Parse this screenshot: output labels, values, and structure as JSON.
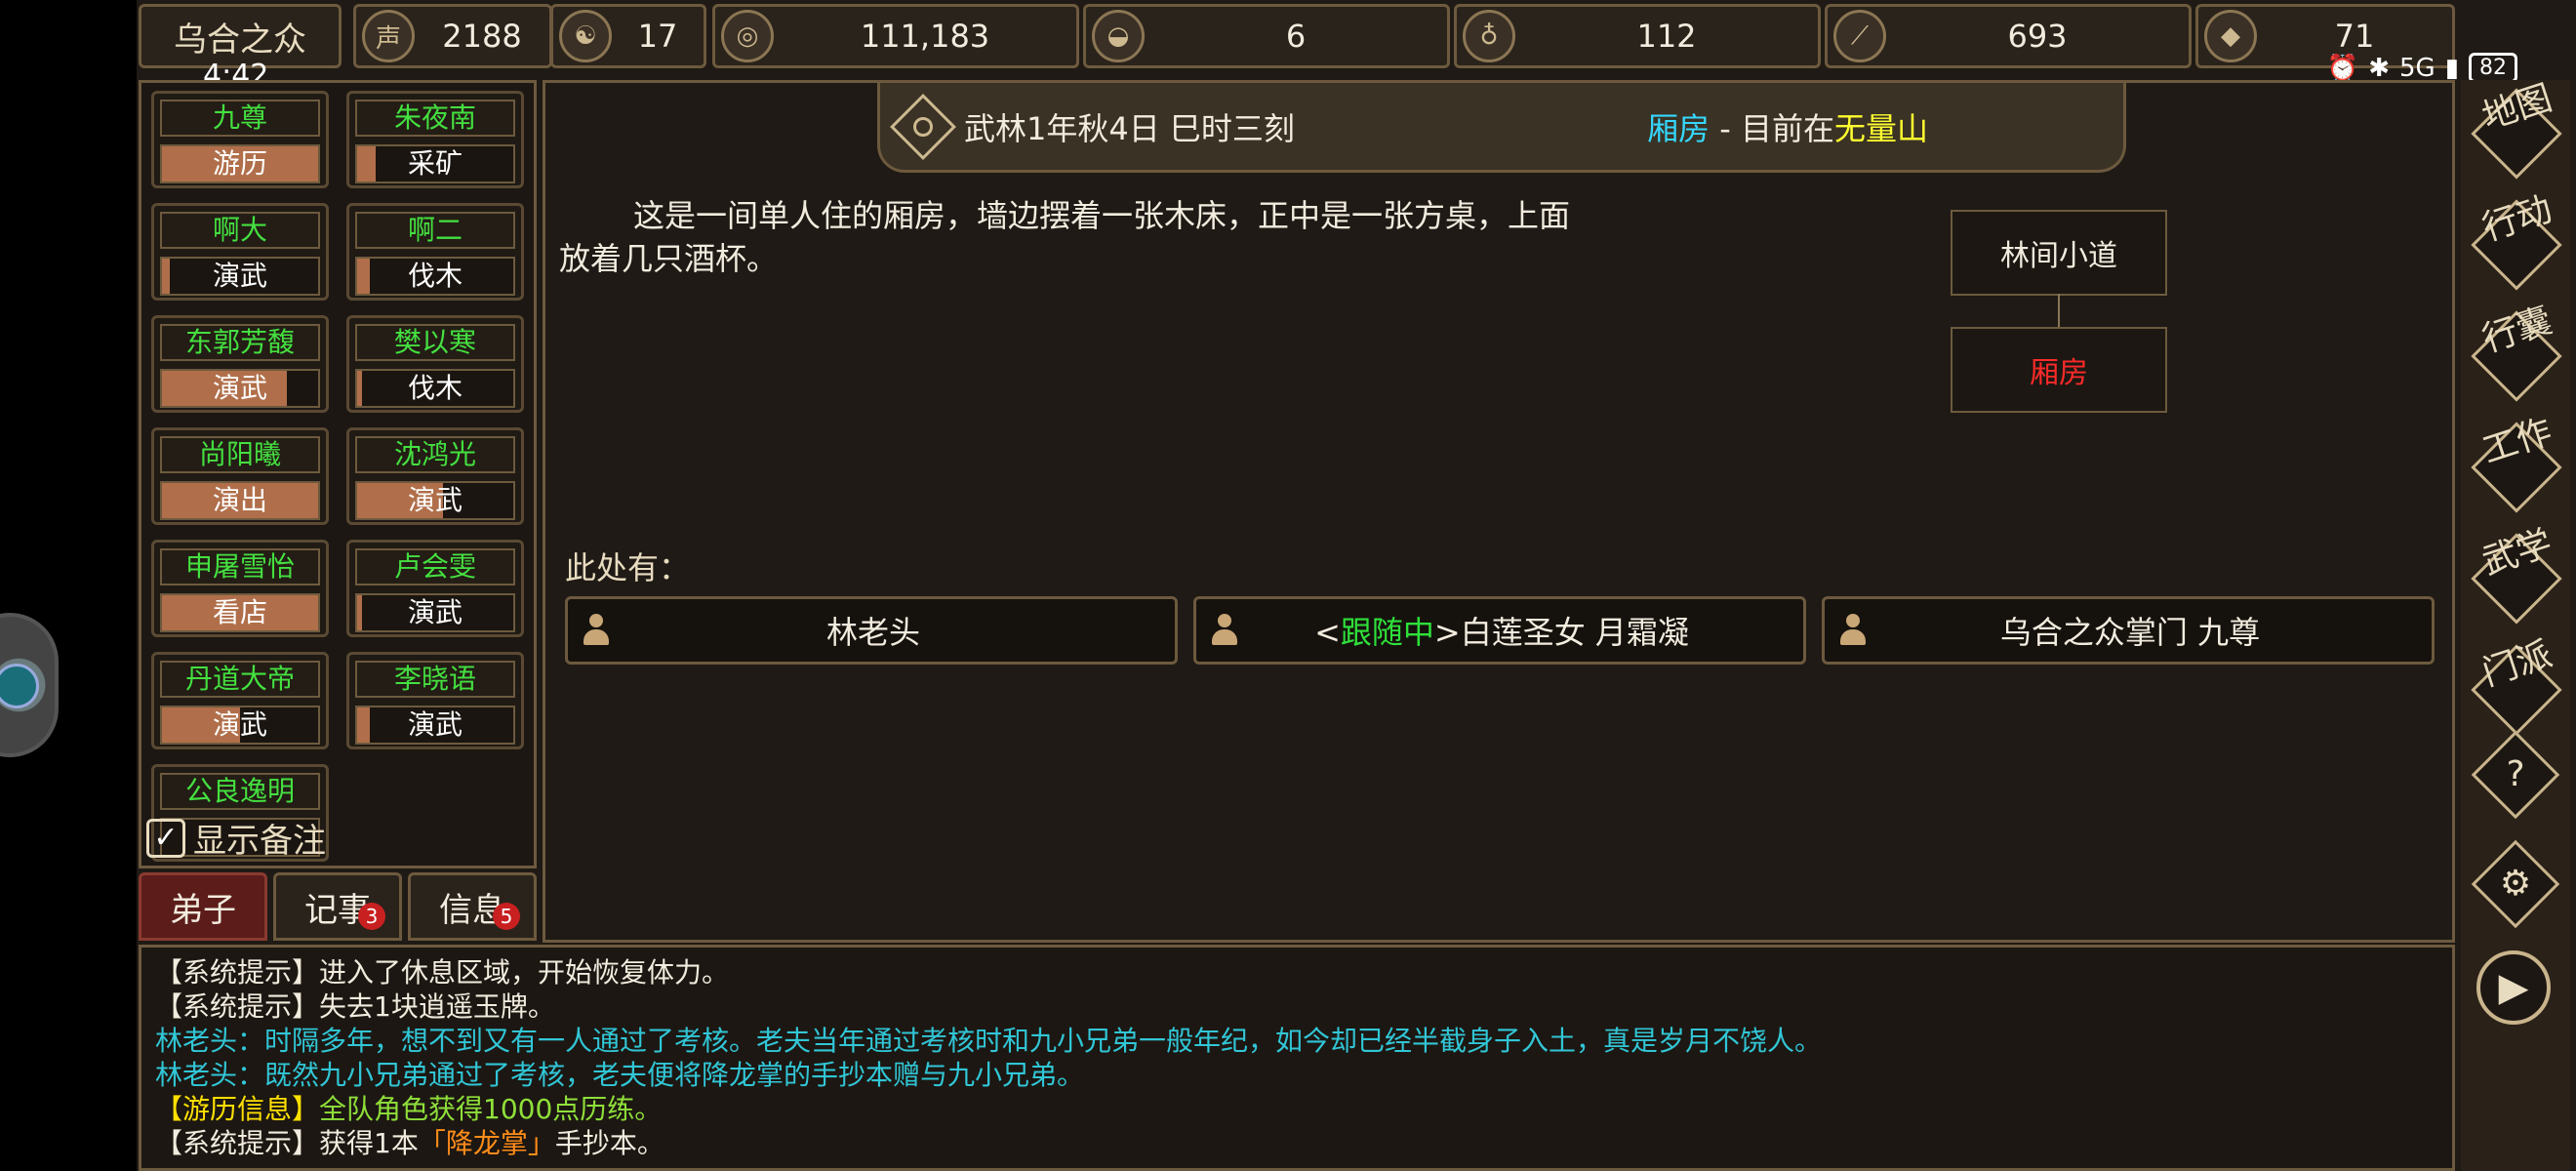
{
  "status_bar": {
    "time": "4:42",
    "battery": "82",
    "signal": "5G"
  },
  "topbar": {
    "sect_name": "乌合之众",
    "resources": [
      {
        "icon": "prestige-icon",
        "glyph": "声",
        "value": "2188"
      },
      {
        "icon": "yin-yang-icon",
        "glyph": "☯",
        "value": "17"
      },
      {
        "icon": "coin-icon",
        "glyph": "◎",
        "value": "111,183"
      },
      {
        "icon": "rice-bowl-icon",
        "glyph": "◒",
        "value": "6"
      },
      {
        "icon": "gourd-icon",
        "glyph": "♁",
        "value": "112"
      },
      {
        "icon": "timber-icon",
        "glyph": "⟋",
        "value": "693"
      },
      {
        "icon": "ore-icon",
        "glyph": "◆",
        "value": "71"
      }
    ]
  },
  "disciples": [
    {
      "name": "九尊",
      "task": "游历",
      "progress": 1.0
    },
    {
      "name": "朱夜南",
      "task": "采矿",
      "progress": 0.12
    },
    {
      "name": "啊大",
      "task": "演武",
      "progress": 0.05
    },
    {
      "name": "啊二",
      "task": "伐木",
      "progress": 0.08
    },
    {
      "name": "东郭芳馥",
      "task": "演武",
      "progress": 0.8
    },
    {
      "name": "樊以寒",
      "task": "伐木",
      "progress": 0.03
    },
    {
      "name": "尚阳曦",
      "task": "演出",
      "progress": 1.0
    },
    {
      "name": "沈鸿光",
      "task": "演武",
      "progress": 0.55
    },
    {
      "name": "申屠雪怡",
      "task": "看店",
      "progress": 1.0
    },
    {
      "name": "卢会雯",
      "task": "演武",
      "progress": 0.03
    },
    {
      "name": "丹道大帝",
      "task": "演武",
      "progress": 0.5
    },
    {
      "name": "李晓语",
      "task": "演武",
      "progress": 0.08
    },
    {
      "name": "公良逸明",
      "task": "",
      "progress": 0
    }
  ],
  "show_notes_label": "显示备注",
  "tabs": [
    {
      "label": "弟子",
      "badge": ""
    },
    {
      "label": "记事",
      "badge": "3"
    },
    {
      "label": "信息",
      "badge": "5"
    }
  ],
  "header": {
    "date": "武林1年秋4日 巳时三刻",
    "room": "厢房",
    "separator": " - 目前在",
    "area": "无量山"
  },
  "description": "这是一间单人住的厢房，墙边摆着一张木床，正中是一张方桌，上面放着几只酒杯。",
  "map": {
    "north": "林间小道",
    "current": "厢房"
  },
  "here_label": "此处有：",
  "npcs": [
    {
      "prefix": "",
      "tag": "",
      "suffix": "",
      "name": "林老头"
    },
    {
      "prefix": "<",
      "tag": "跟随中",
      "suffix": ">",
      "name": "白莲圣女 月霜凝"
    },
    {
      "prefix": "",
      "tag": "",
      "suffix": "",
      "name": "乌合之众掌门 九尊"
    }
  ],
  "right_menu": [
    "地图",
    "行动",
    "行囊",
    "工作",
    "武学",
    "门派"
  ],
  "right_buttons": {
    "help": "?",
    "settings": "⚙",
    "play": "▶"
  },
  "log": [
    {
      "tag": "【系统提示】",
      "text": "进入了休息区域，开始恢复体力。",
      "style": "sys"
    },
    {
      "tag": "【系统提示】",
      "text": "失去1块逍遥玉牌。",
      "style": "sys"
    },
    {
      "tag": "",
      "text": "林老头：时隔多年，想不到又有一人通过了考核。老夫当年通过考核时和九小兄弟一般年纪，如今却已经半截身子入土，真是岁月不饶人。",
      "style": "npcsay"
    },
    {
      "tag": "",
      "text": "林老头：既然九小兄弟通过了考核，老夫便将降龙掌的手抄本赠与九小兄弟。",
      "style": "npcsay"
    },
    {
      "tag": "【游历信息】",
      "text": "全队角色获得1000点历练。",
      "style": "travel"
    },
    {
      "tag": "【系统提示】",
      "pre": "获得1本",
      "item": "「降龙掌」",
      "post": "手抄本。",
      "style": "item"
    }
  ]
}
